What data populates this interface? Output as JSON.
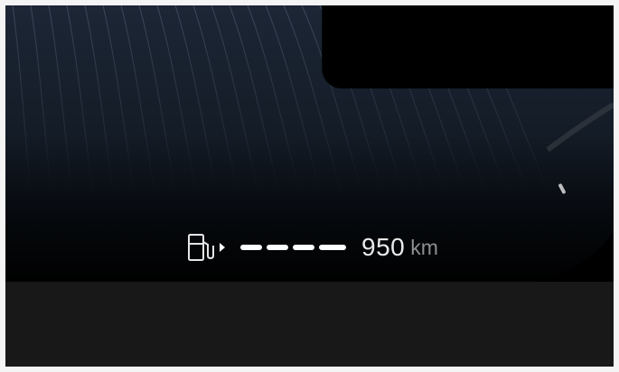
{
  "cluster": {
    "range": {
      "value": "950",
      "unit": "km",
      "segments_filled": 4,
      "icon": "fuel-pump-icon"
    }
  },
  "colors": {
    "background": "#000000",
    "wave": "#1a2431",
    "text_primary": "#e9e9e9",
    "text_secondary": "#8f8f8f",
    "bottom_strip": "#181818"
  }
}
